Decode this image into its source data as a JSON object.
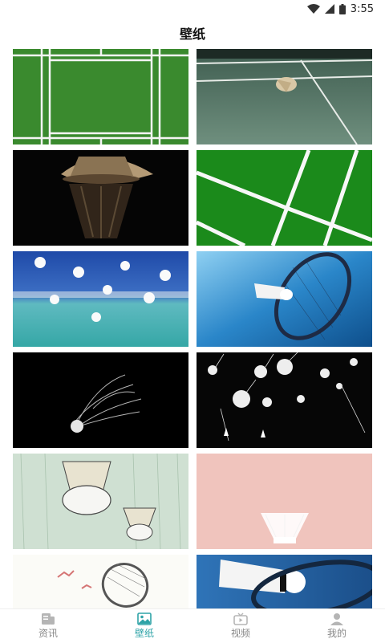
{
  "status": {
    "time": "3:55"
  },
  "header": {
    "title": "壁纸"
  },
  "tabs": [
    {
      "label": "资讯",
      "icon": "news-icon",
      "active": false
    },
    {
      "label": "壁纸",
      "icon": "image-icon",
      "active": true
    },
    {
      "label": "视频",
      "icon": "tv-icon",
      "active": false
    },
    {
      "label": "我的",
      "icon": "profile-icon",
      "active": false
    }
  ],
  "colors": {
    "accent": "#2ea3a7",
    "inactive": "#888888"
  }
}
